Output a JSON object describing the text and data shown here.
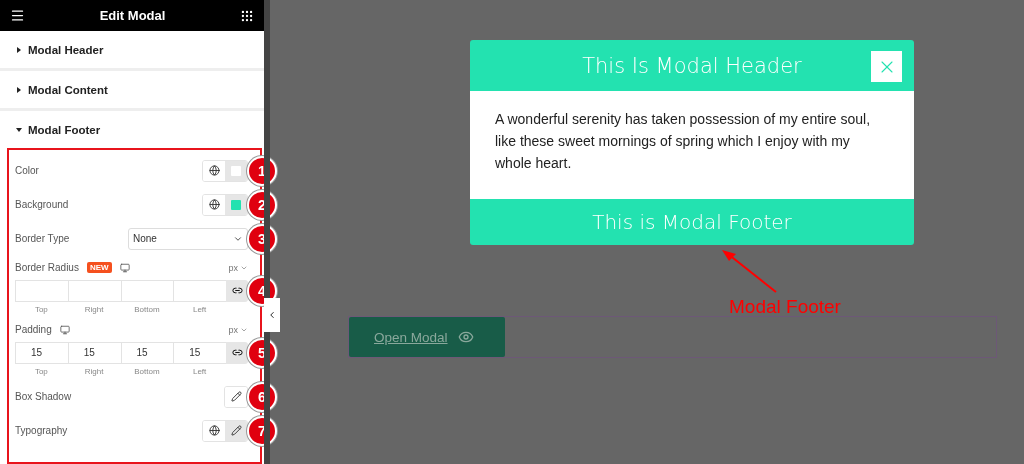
{
  "panel": {
    "title": "Edit Modal",
    "sections": [
      {
        "label": "Modal Header",
        "expanded": false
      },
      {
        "label": "Modal Content",
        "expanded": false
      },
      {
        "label": "Modal Footer",
        "expanded": true
      }
    ],
    "controls": [
      {
        "kind": "color",
        "label": "Color",
        "color": "#ffffff",
        "marker": "1"
      },
      {
        "kind": "color",
        "label": "Background",
        "color": "#23e2b0",
        "marker": "2"
      },
      {
        "kind": "select",
        "label": "Border Type",
        "value": "None",
        "marker": "3"
      },
      {
        "kind": "dimensions",
        "label": "Border Radius",
        "badge": "NEW",
        "unit": "px",
        "sublabels": [
          "Top",
          "Right",
          "Bottom",
          "Left"
        ],
        "marker": "4"
      },
      {
        "kind": "dimensions",
        "label": "Padding",
        "unit": "px",
        "values": [
          "15",
          "15",
          "15",
          "15"
        ],
        "sublabels": [
          "Top",
          "Right",
          "Bottom",
          "Left"
        ],
        "marker": "5"
      },
      {
        "kind": "popover",
        "label": "Box Shadow",
        "marker": "6"
      },
      {
        "kind": "typography",
        "label": "Typography",
        "marker": "7"
      }
    ]
  },
  "modal": {
    "header": "This Is Modal Header",
    "body": "A wonderful serenity has taken possession of my entire soul, like these sweet mornings of spring which I enjoy with my whole heart.",
    "footer": "This is Modal Footer"
  },
  "callout": "Modal Footer",
  "open_button": {
    "label": "Open Modal"
  }
}
